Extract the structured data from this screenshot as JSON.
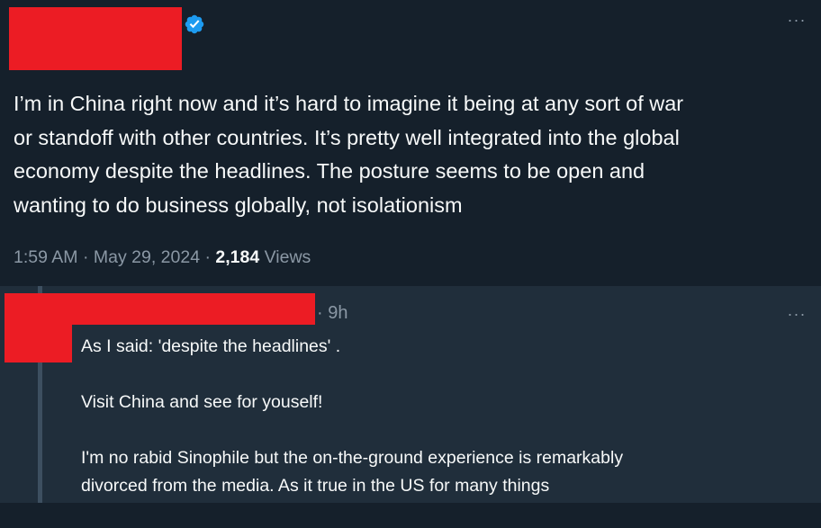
{
  "main_tweet": {
    "text_lines": [
      "I’m in China right now and it’s hard to imagine it being at any sort of war",
      "or standoff with other countries. It’s pretty well integrated into the global",
      "economy despite the headlines. The posture seems to be open and",
      "wanting to do business globally, not isolationism"
    ],
    "time": "1:59 AM",
    "separator": "·",
    "date": "May 29, 2024",
    "views_count": "2,184",
    "views_label": "Views",
    "verified_icon": "verified-badge-icon",
    "more_icon": "more-options-icon",
    "more_glyph": "···"
  },
  "reply": {
    "time": "· 9h",
    "more_glyph": "···",
    "paragraphs": [
      [
        "As I said: 'despite the headlines' ."
      ],
      [
        "Visit China and see for youself!"
      ],
      [
        "I'm no rabid Sinophile but the on-the-ground experience is remarkably",
        "divorced from the media. As it true in the US for many things"
      ]
    ]
  },
  "colors": {
    "background_main": "#15202b",
    "background_reply": "#202e3b",
    "text_primary": "#f7f9f9",
    "text_secondary": "#8b98a5",
    "verified_blue": "#1d9bf0",
    "redaction": "#ec1c24"
  }
}
